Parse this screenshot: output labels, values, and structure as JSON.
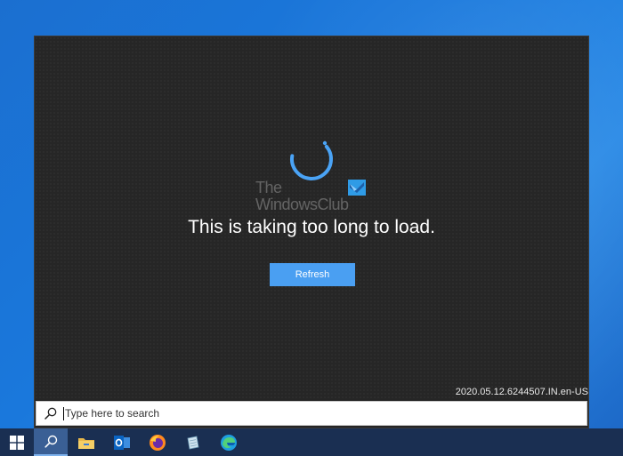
{
  "error_panel": {
    "watermark_line1": "The",
    "watermark_line2": "WindowsClub",
    "message": "This is taking too long to load.",
    "refresh_label": "Refresh",
    "version": "2020.05.12.6244507.IN.en-US"
  },
  "search": {
    "placeholder": "Type here to search",
    "value": ""
  },
  "taskbar": {
    "items": [
      {
        "name": "start",
        "icon": "windows-logo-icon"
      },
      {
        "name": "search",
        "icon": "search-icon",
        "active": true
      },
      {
        "name": "file-explorer",
        "icon": "folder-icon"
      },
      {
        "name": "outlook",
        "icon": "outlook-icon"
      },
      {
        "name": "firefox",
        "icon": "firefox-icon"
      },
      {
        "name": "notepad",
        "icon": "notepad-icon"
      },
      {
        "name": "edge",
        "icon": "edge-icon"
      }
    ]
  },
  "colors": {
    "accent": "#4a9ff2",
    "panel_bg": "#262626",
    "taskbar_bg": "#1a2f52",
    "spinner": "#4aa3f5"
  }
}
